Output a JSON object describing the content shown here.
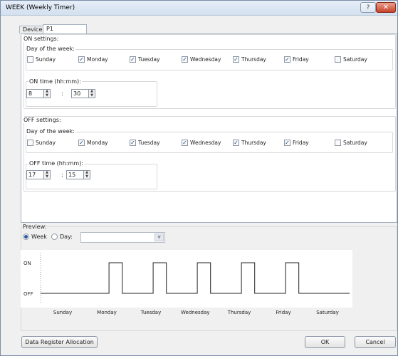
{
  "window": {
    "title": "WEEK (Weekly Timer)",
    "help_glyph": "?",
    "close_glyph": "✕"
  },
  "tabs": [
    {
      "label": "Devices"
    },
    {
      "label": "P1"
    }
  ],
  "on_settings": {
    "title": "ON settings:",
    "day_group_label": "Day of the week:",
    "days": [
      {
        "label": "Sunday",
        "checked": false
      },
      {
        "label": "Monday",
        "checked": true
      },
      {
        "label": "Tuesday",
        "checked": true
      },
      {
        "label": "Wednesday",
        "checked": true
      },
      {
        "label": "Thursday",
        "checked": true
      },
      {
        "label": "Friday",
        "checked": true
      },
      {
        "label": "Saturday",
        "checked": false
      }
    ],
    "time_label": "ON time (hh:mm):",
    "hour": "8",
    "minute": "30"
  },
  "off_settings": {
    "title": "OFF settings:",
    "day_group_label": "Day of the week:",
    "days": [
      {
        "label": "Sunday",
        "checked": false
      },
      {
        "label": "Monday",
        "checked": true
      },
      {
        "label": "Tuesday",
        "checked": true
      },
      {
        "label": "Wednesday",
        "checked": true
      },
      {
        "label": "Thursday",
        "checked": true
      },
      {
        "label": "Friday",
        "checked": true
      },
      {
        "label": "Saturday",
        "checked": false
      }
    ],
    "time_label": "OFF time (hh:mm):",
    "hour": "17",
    "minute": "15"
  },
  "time_separator": ":",
  "check_glyph": "✓",
  "spin_up": "▲",
  "spin_down": "▼",
  "dropdown_glyph": "▼",
  "preview": {
    "title": "Preview:",
    "week_label": "Week",
    "day_label": "Day:",
    "mode": "Week",
    "day_value": ""
  },
  "chart_data": {
    "type": "line",
    "y_levels": [
      "ON",
      "OFF"
    ],
    "categories": [
      "Sunday",
      "Monday",
      "Tuesday",
      "Wednesday",
      "Thursday",
      "Friday",
      "Saturday"
    ],
    "series": [
      {
        "values": [
          0,
          1,
          1,
          1,
          1,
          1,
          0
        ]
      }
    ],
    "step": true
  },
  "buttons": {
    "data_register": "Data Register Allocation",
    "ok": "OK",
    "cancel": "Cancel"
  },
  "colors": {
    "signal": "#222222",
    "accent": "#2b5aa0"
  }
}
